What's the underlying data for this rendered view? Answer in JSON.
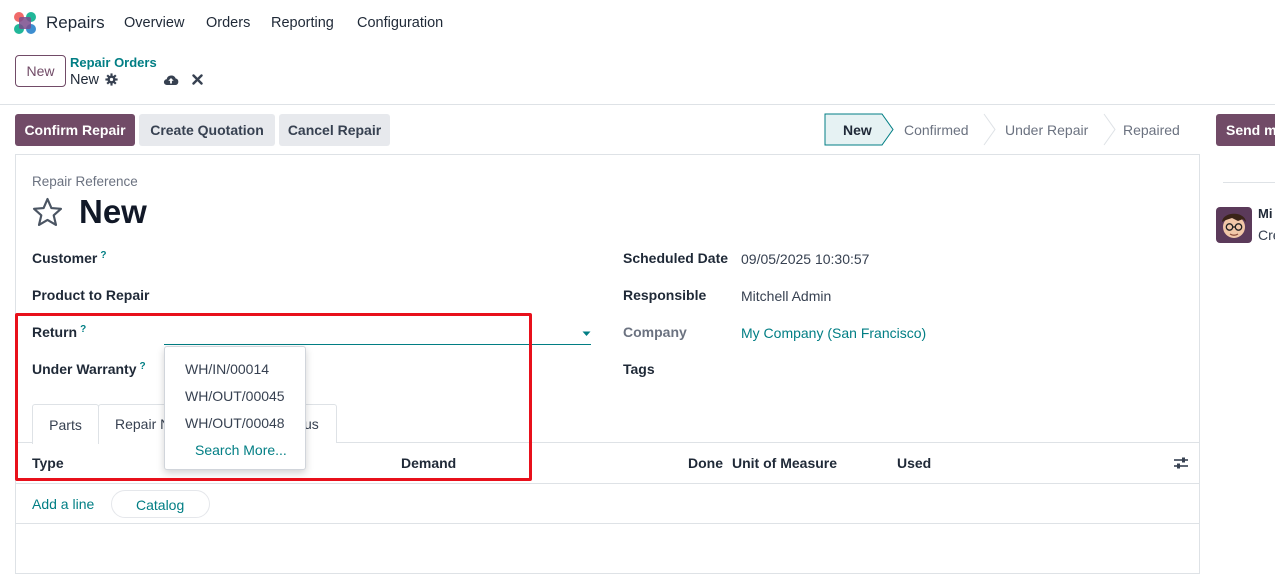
{
  "app": {
    "name": "Repairs"
  },
  "menu": {
    "overview": "Overview",
    "orders": "Orders",
    "reporting": "Reporting",
    "configuration": "Configuration"
  },
  "control": {
    "new_label": "New",
    "breadcrumb_parent": "Repair Orders",
    "breadcrumb_current": "New"
  },
  "actions": {
    "confirm": "Confirm Repair",
    "quotation": "Create Quotation",
    "cancel": "Cancel Repair",
    "send": "Send m"
  },
  "status": {
    "steps": [
      "New",
      "Confirmed",
      "Under Repair",
      "Repaired"
    ],
    "active": "New"
  },
  "form": {
    "ref_label": "Repair Reference",
    "title": "New",
    "customer_label": "Customer",
    "product_label": "Product to Repair",
    "return_label": "Return",
    "warranty_label": "Under Warranty",
    "help_mark": "?",
    "scheduled_label": "Scheduled Date",
    "scheduled_value": "09/05/2025 10:30:57",
    "responsible_label": "Responsible",
    "responsible_value": "Mitchell Admin",
    "company_label": "Company",
    "company_value": "My Company (San Francisco)",
    "tags_label": "Tags"
  },
  "dropdown": {
    "items": [
      "WH/IN/00014",
      "WH/OUT/00045",
      "WH/OUT/00048"
    ],
    "search_more": "Search More..."
  },
  "tabs": {
    "parts": "Parts",
    "repair_notes": "Repair N",
    "misc_tail": "us"
  },
  "table": {
    "headers": {
      "type": "Type",
      "demand": "Demand",
      "done": "Done",
      "uom": "Unit of Measure",
      "used": "Used"
    },
    "add_line": "Add a line",
    "catalog": "Catalog"
  },
  "chatter": {
    "name_partial": "Mi",
    "text_partial": "Cre"
  },
  "colors": {
    "brand": "#714B67",
    "link": "#017e84",
    "highlight": "#e8101b"
  }
}
